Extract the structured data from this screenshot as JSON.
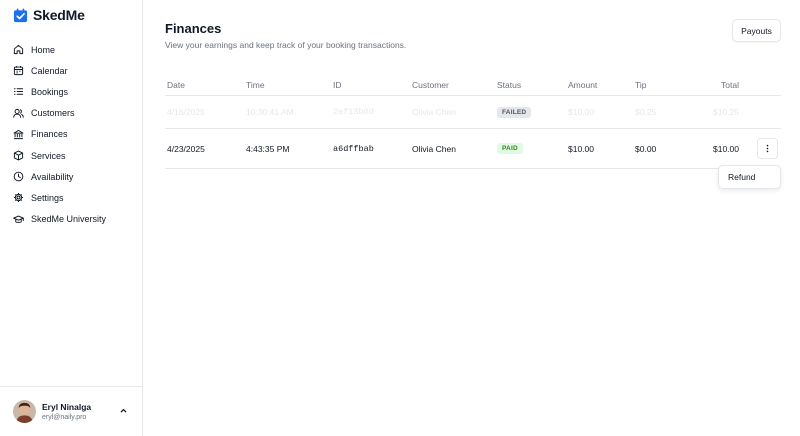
{
  "app": {
    "name": "SkedMe",
    "brand_color": "#1d6ff2"
  },
  "sidebar": {
    "items": [
      {
        "label": "Home",
        "icon": "home-icon"
      },
      {
        "label": "Calendar",
        "icon": "calendar-icon"
      },
      {
        "label": "Bookings",
        "icon": "list-icon"
      },
      {
        "label": "Customers",
        "icon": "users-icon"
      },
      {
        "label": "Finances",
        "icon": "bank-icon"
      },
      {
        "label": "Services",
        "icon": "package-icon"
      },
      {
        "label": "Availability",
        "icon": "clock-icon"
      },
      {
        "label": "Settings",
        "icon": "gear-icon"
      },
      {
        "label": "SkedMe University",
        "icon": "graduation-cap-icon"
      }
    ]
  },
  "user": {
    "name": "Eryl Ninalga",
    "email": "eryl@naily.pro"
  },
  "main": {
    "title": "Finances",
    "subtitle": "View your earnings and keep track of your booking transactions.",
    "payouts_label": "Payouts"
  },
  "table": {
    "headers": {
      "date": "Date",
      "time": "Time",
      "id": "ID",
      "customer": "Customer",
      "status": "Status",
      "amount": "Amount",
      "tip": "Tip",
      "total": "Total"
    },
    "rows": [
      {
        "date": "4/16/2025",
        "time": "10:30:41 AM",
        "id": "2ef13b0d",
        "customer": "Olivia Chen",
        "status": "FAILED",
        "amount": "$10.00",
        "tip": "$0.25",
        "total": "$10.25"
      },
      {
        "date": "4/23/2025",
        "time": "4:43:35 PM",
        "id": "a6dffbab",
        "customer": "Olivia Chen",
        "status": "PAID",
        "amount": "$10.00",
        "tip": "$0.00",
        "total": "$10.00"
      }
    ]
  },
  "row_menu": {
    "items": [
      {
        "label": "Refund"
      }
    ]
  }
}
